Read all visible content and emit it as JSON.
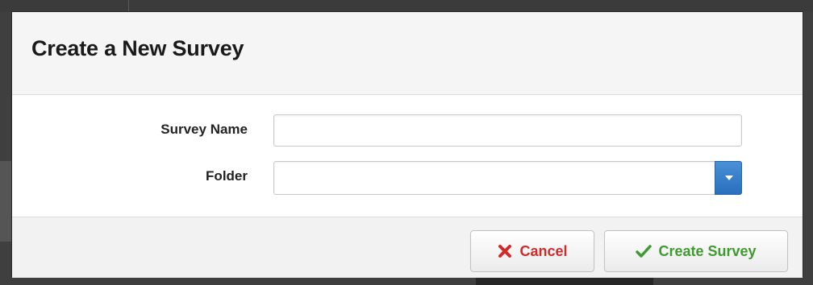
{
  "dialog": {
    "title": "Create a New Survey",
    "fields": {
      "survey_name": {
        "label": "Survey Name",
        "value": "",
        "placeholder": ""
      },
      "folder": {
        "label": "Folder",
        "value": ""
      }
    },
    "buttons": {
      "cancel": "Cancel",
      "create": "Create Survey"
    }
  },
  "icons": {
    "cancel": "close-x-icon",
    "create": "checkmark-icon",
    "folder_dropdown": "chevron-down-icon"
  },
  "colors": {
    "cancel_text": "#d22a2a",
    "create_text": "#3f9a2f",
    "dropdown_accent": "#3a7fcb"
  }
}
